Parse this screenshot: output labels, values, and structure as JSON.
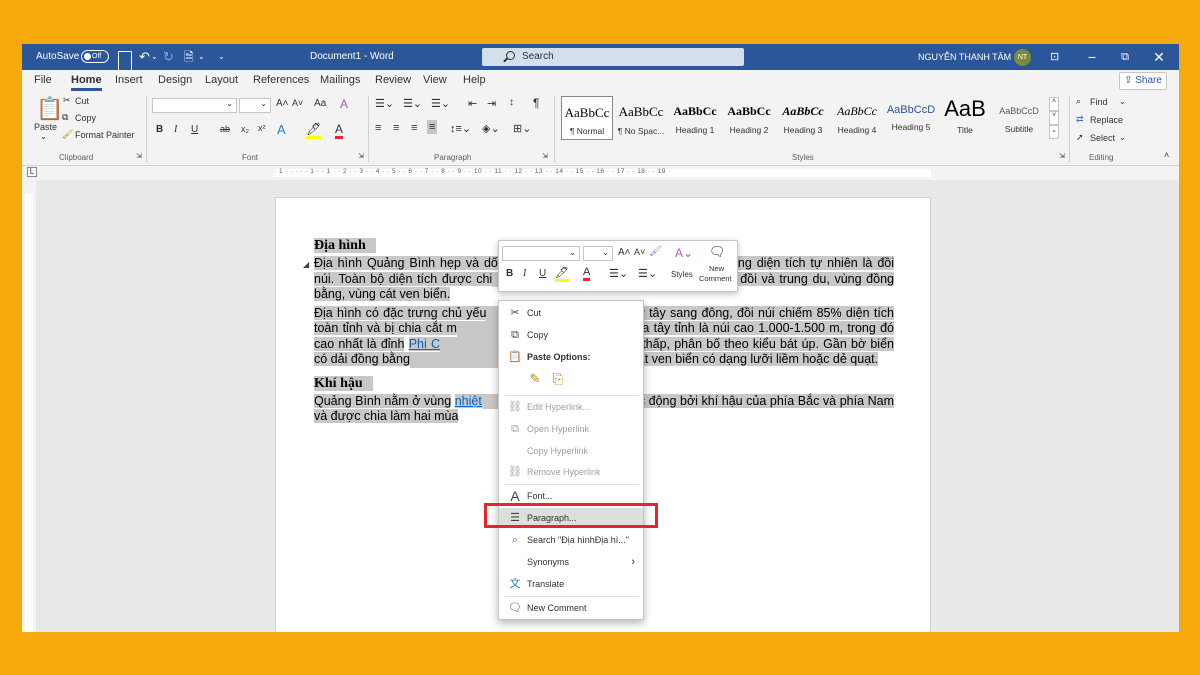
{
  "titlebar": {
    "autosave_label": "AutoSave",
    "autosave_state": "Off",
    "doc_title": "Document1 - Word",
    "search_placeholder": "Search",
    "user_name": "NGUYỄN THANH TÂM",
    "user_initials": "NT"
  },
  "menu": {
    "tabs": [
      "File",
      "Home",
      "Insert",
      "Design",
      "Layout",
      "References",
      "Mailings",
      "Review",
      "View",
      "Help"
    ],
    "active": "Home",
    "share_label": "Share"
  },
  "ribbon": {
    "clipboard": {
      "paste": "Paste",
      "cut": "Cut",
      "copy": "Copy",
      "format_painter": "Format Painter",
      "label": "Clipboard"
    },
    "font": {
      "label": "Font",
      "case": "Aa"
    },
    "paragraph": {
      "label": "Paragraph"
    },
    "styles": {
      "label": "Styles",
      "items": [
        {
          "preview": "AaBbCc",
          "name": "¶ Normal"
        },
        {
          "preview": "AaBbCc",
          "name": "¶ No Spac..."
        },
        {
          "preview": "AaBbCc",
          "name": "Heading 1"
        },
        {
          "preview": "AaBbCc",
          "name": "Heading 2"
        },
        {
          "preview": "AaBbCc",
          "name": "Heading 3"
        },
        {
          "preview": "AaBbCc",
          "name": "Heading 4"
        },
        {
          "preview": "AaBbCcD",
          "name": "Heading 5"
        },
        {
          "preview": "AaB",
          "name": "Title"
        },
        {
          "preview": "AaBbCcD",
          "name": "Subtitle"
        }
      ]
    },
    "editing": {
      "label": "Editing",
      "find": "Find",
      "replace": "Replace",
      "select": "Select"
    }
  },
  "ruler": {
    "marks": "· 1 · · · · · 1 · · 1 · · 2 · · 3 · · 4 · · 5 · · 6 · · 7 · · 8 · · 9 · · 10 · · 11 · · 12 · · 13 · · 14 · · 15 · · 16 · · 17 · · 18 · · 19 ·"
  },
  "document": {
    "heading1": "Địa hình",
    "para1_a": "Địa hình Quảng Bình hẹp và dố",
    "para1_b": "ng diện tích tự nhiên là đồi núi. Toàn bộ diện tích được chi",
    "para1_c": "cao, vùng đồi và trung du, vùng đồng bằng, vùng cát ven biển.",
    "para2_a": "Địa hình có đặc trưng chủ yếu",
    "para2_b": "ừ tây sang đông, đồi núi chiếm 85% diện tích toàn tỉnh và bị chia cắt m",
    "para2_c": "ng phía tây tỉnh là núi cao 1.000-1.500 m, trong đó cao nhất là đỉnh",
    "para2_link": "Phi C",
    "para2_d": "vùng đồi thấp, phân bố theo kiểu bát úp. Gần bờ biển có dải đồng bằng",
    "para2_e": "những tràng cát ven biển có dạng lưỡi liềm hoặc dẻ quạt.",
    "heading2": "Khí hậu",
    "para3_a": "Quảng Bình nằm ở vùng",
    "para3_link": "nhiệt",
    "para3_b": "ác động bởi khí hậu của phía Bắc và phía Nam và được chia làm hai mùa"
  },
  "mini_toolbar": {
    "styles": "Styles",
    "new_comment_1": "New",
    "new_comment_2": "Comment"
  },
  "context_menu": {
    "cut": "Cut",
    "copy": "Copy",
    "paste_options": "Paste Options:",
    "edit_hyperlink": "Edit Hyperlink...",
    "open_hyperlink": "Open Hyperlink",
    "copy_hyperlink": "Copy Hyperlink",
    "remove_hyperlink": "Remove Hyperlink",
    "font": "Font...",
    "paragraph": "Paragraph...",
    "search": "Search \"Địa hìnhĐịa hì...\"",
    "synonyms": "Synonyms",
    "translate": "Translate",
    "new_comment": "New Comment"
  },
  "colors": {
    "word_blue": "#2B579A",
    "background": "#F5A90D",
    "callout": "#E8262A",
    "highlight": "#C8C8C8"
  }
}
